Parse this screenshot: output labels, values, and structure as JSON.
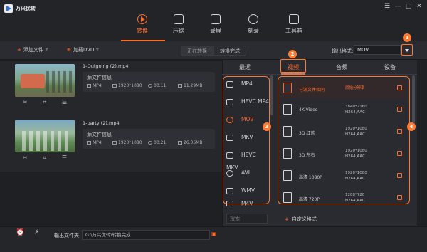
{
  "app": {
    "title": "万兴优转",
    "window_controls": [
      "☰",
      "—",
      "□",
      "✕"
    ]
  },
  "main_tabs": [
    {
      "label": "转换",
      "icon": "play-circle-icon",
      "active": true
    },
    {
      "label": "压缩",
      "icon": "compress-icon"
    },
    {
      "label": "录屏",
      "icon": "video-camera-icon"
    },
    {
      "label": "刻录",
      "icon": "disc-icon"
    },
    {
      "label": "工具箱",
      "icon": "toolbox-icon"
    }
  ],
  "toolbar": {
    "add_file": "添加文件",
    "load_dvd": "加载DVD",
    "seg_converting": "正在转换",
    "seg_done": "转换完成",
    "output_format_label": "输出格式:",
    "output_format_value": "MOV"
  },
  "files": [
    {
      "name": "1-Outgoing (2).mp4",
      "info_title": "源文件信息",
      "format": "MP4",
      "resolution": "1920*1080",
      "duration": "00:11",
      "size": "11.29MB"
    },
    {
      "name": "1-party (2).mp4",
      "info_title": "源文件信息",
      "format": "MP4",
      "resolution": "1920*1080",
      "duration": "00:21",
      "size": "26.05MB"
    }
  ],
  "format_panel": {
    "tabs": [
      "最近",
      "视频",
      "音频",
      "设备"
    ],
    "active_tab": 1,
    "formats": [
      "MP4",
      "HEVC MP4",
      "MOV",
      "MKV",
      "HEVC MKV",
      "AVI",
      "WMV",
      "M4V"
    ],
    "selected_format": "MOV",
    "resolutions": [
      {
        "name": "与源文件相同",
        "res": "原始分辨率",
        "codec": "",
        "selected": true
      },
      {
        "name": "4K Video",
        "res": "3840*2160",
        "codec": "H264,AAC"
      },
      {
        "name": "3D 红蓝",
        "res": "1920*1080",
        "codec": "H264,AAC"
      },
      {
        "name": "3D 左右",
        "res": "1920*1080",
        "codec": "H264,AAC"
      },
      {
        "name": "高清 1080P",
        "res": "1920*1080",
        "codec": "H264,AAC"
      },
      {
        "name": "高清 720P",
        "res": "1280*720",
        "codec": "H264,AAC"
      }
    ],
    "search_placeholder": "搜索",
    "custom_format": "自定义格式"
  },
  "bottom": {
    "output_folder_label": "输出文件夹",
    "output_path": "G:\\万兴优转\\转换完成"
  },
  "callouts": [
    "1",
    "2",
    "3",
    "4"
  ],
  "colors": {
    "accent": "#ff6a2b",
    "background": "#1f2024"
  }
}
